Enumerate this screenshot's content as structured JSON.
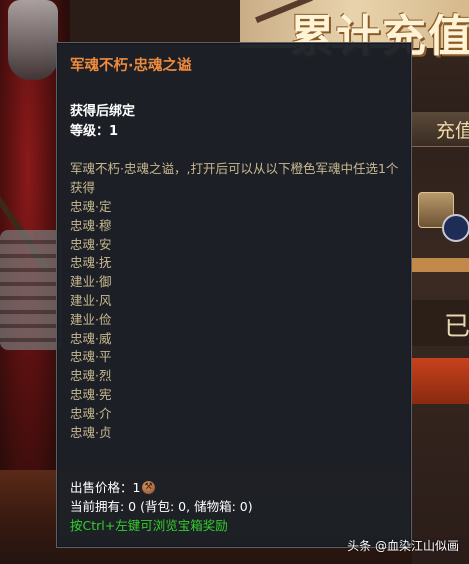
{
  "background": {
    "banner_title": "累计充值",
    "tab_label": "充值",
    "button_label": "已"
  },
  "tooltip": {
    "item_name": "军魂不朽·忠魂之谥",
    "bind_status": "获得后绑定",
    "level_label": "等级：",
    "level_value": "1",
    "description": "军魂不朽·忠魂之谥，,打开后可以从以下橙色军魂中任选1个获得",
    "choices": [
      "忠魂·定",
      "忠魂·穆",
      "忠魂·安",
      "忠魂·抚",
      "建业·御",
      "建业·风",
      "建业·俭",
      "忠魂·威",
      "忠魂·平",
      "忠魂·烈",
      "忠魂·宪",
      "忠魂·介",
      "忠魂·贞"
    ],
    "price_label": "出售价格：",
    "price_value": "1",
    "owned_text": "当前拥有: 0 (背包: 0, 储物箱: 0)",
    "hint_text": "按Ctrl+左键可浏览宝箱奖励"
  },
  "watermark": "头条 @血染江山似画",
  "colors": {
    "item_name": "#f08a3c",
    "description": "#c8b890",
    "hint": "#33d12c",
    "panel_bg": "#1c2026"
  },
  "icons": {
    "currency": "coin-icon"
  }
}
